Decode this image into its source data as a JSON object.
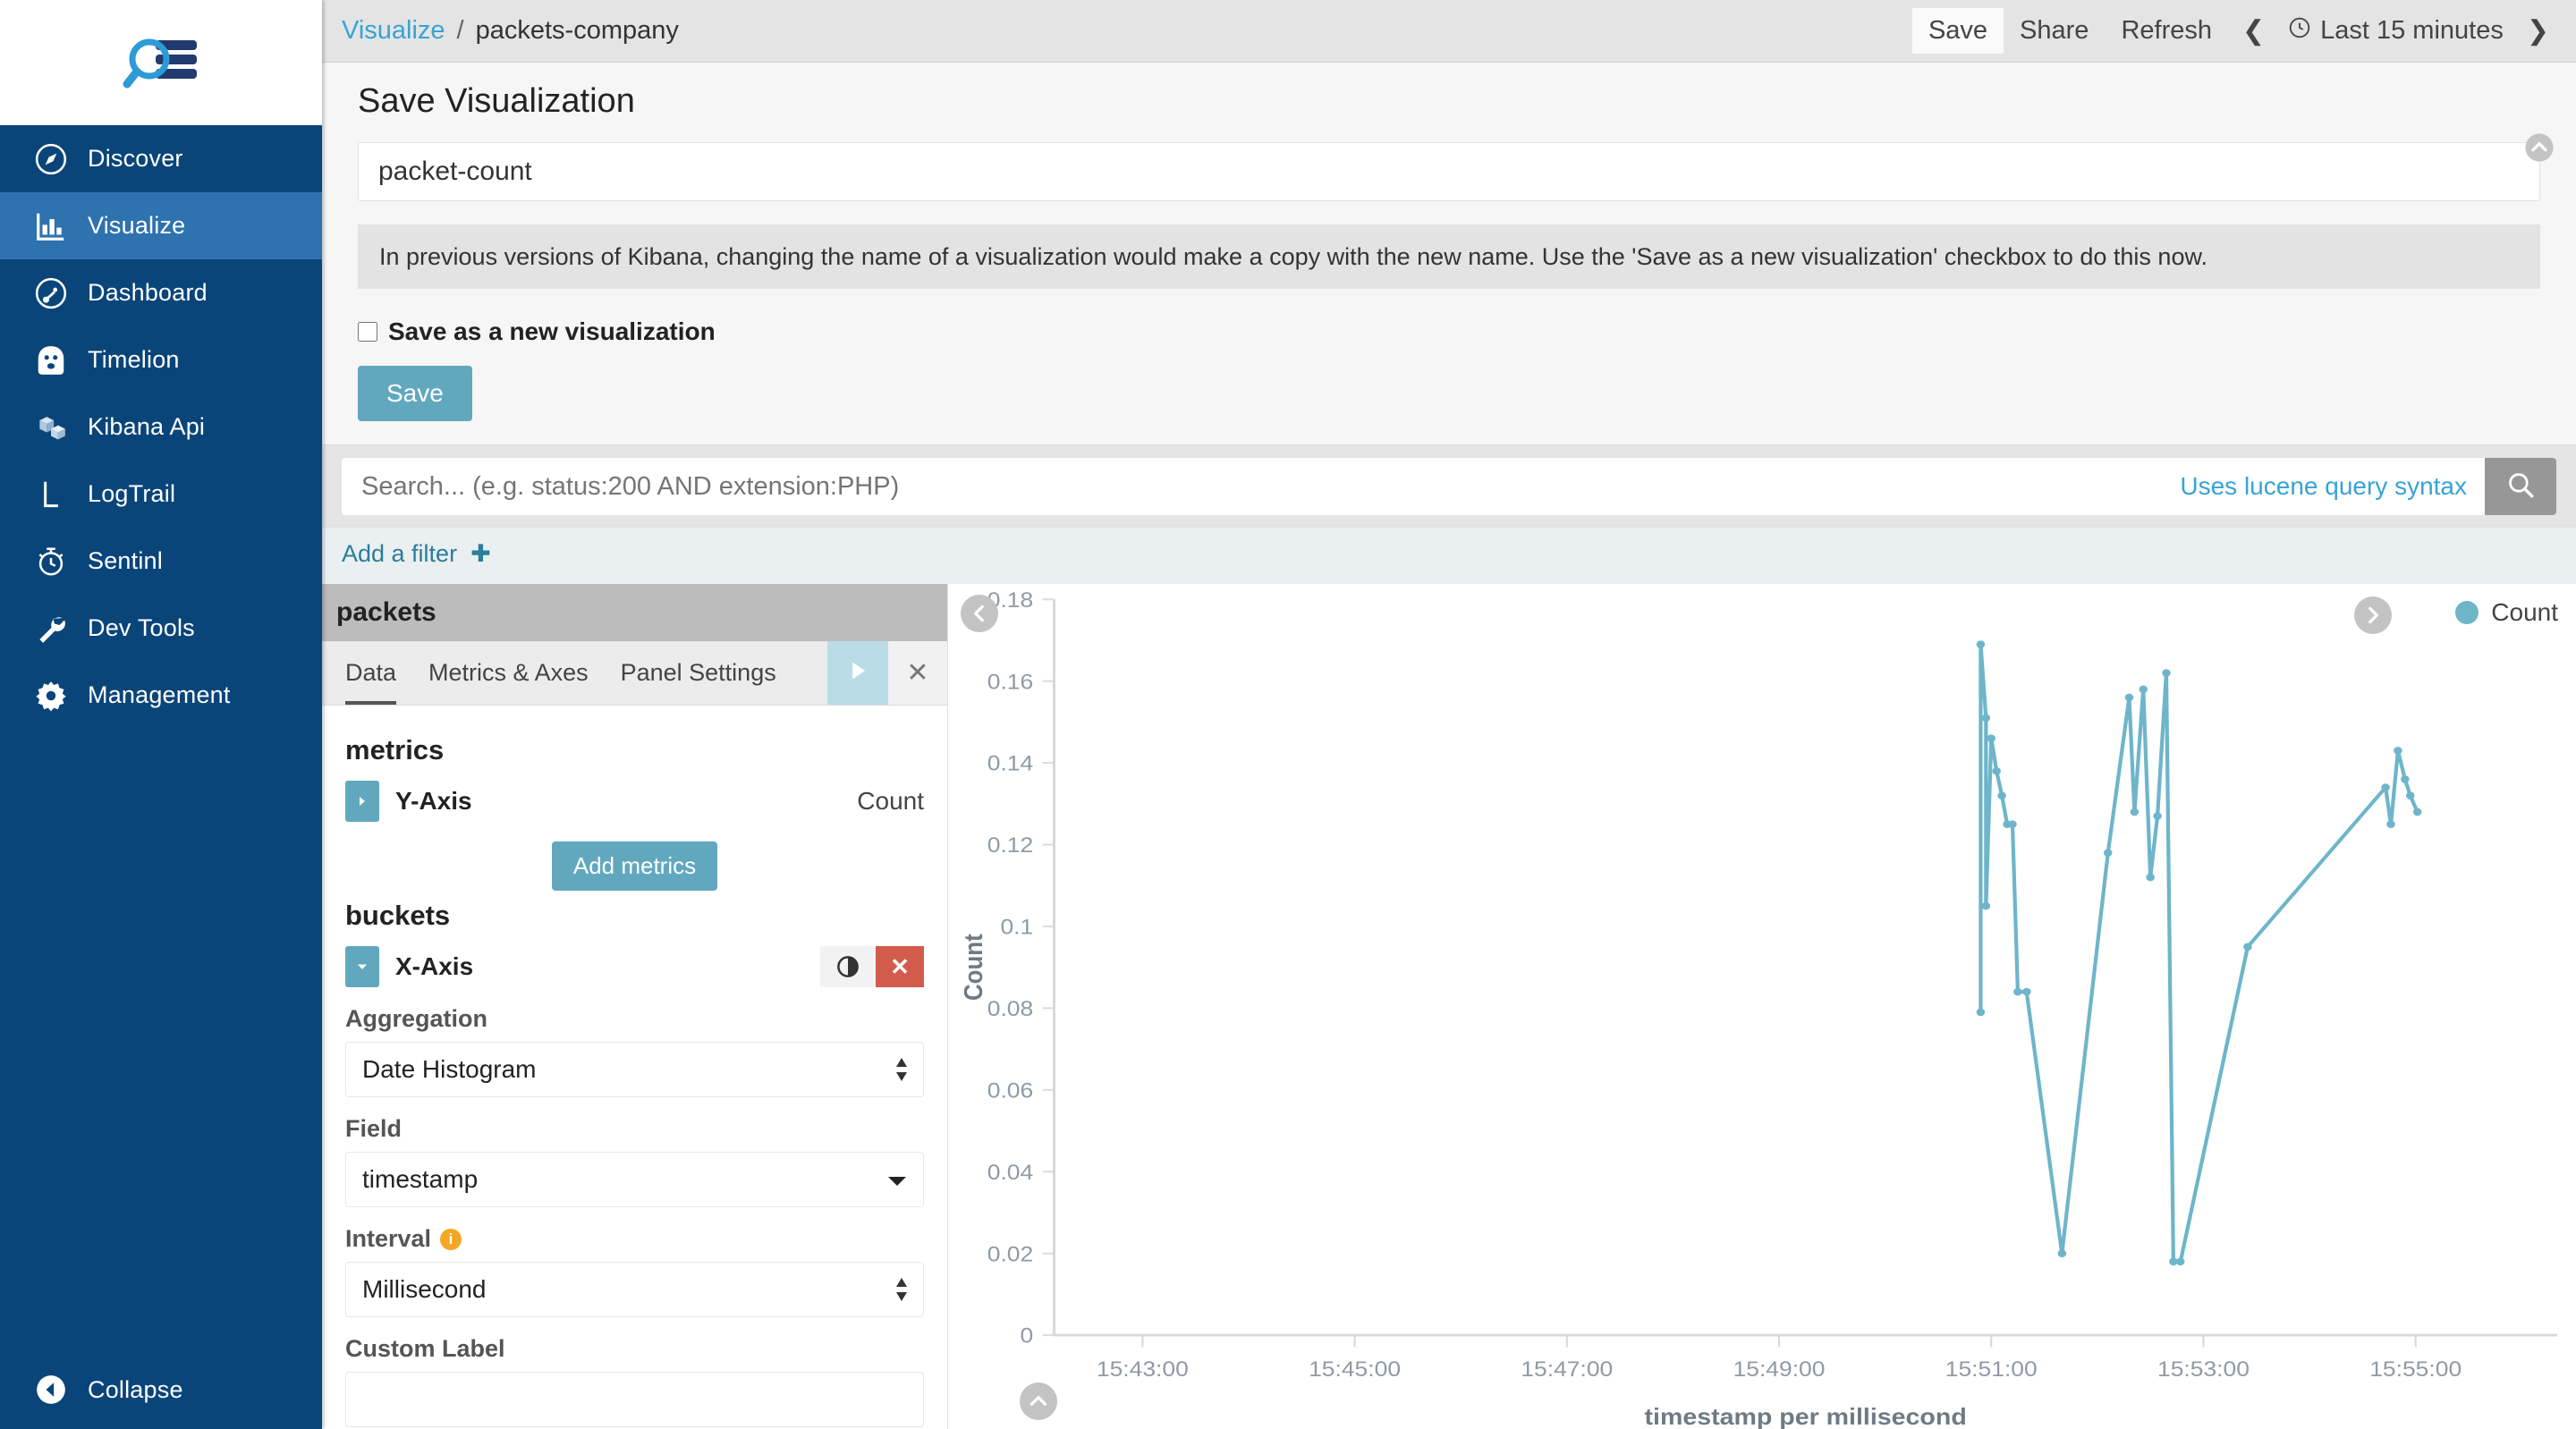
{
  "sidebar": {
    "logo_name": "kibana-logo",
    "items": [
      {
        "label": "Discover",
        "icon": "compass-icon",
        "active": false
      },
      {
        "label": "Visualize",
        "icon": "bar-chart-icon",
        "active": true
      },
      {
        "label": "Dashboard",
        "icon": "dashboard-icon",
        "active": false
      },
      {
        "label": "Timelion",
        "icon": "timelion-icon",
        "active": false
      },
      {
        "label": "Kibana Api",
        "icon": "cubes-icon",
        "active": false
      },
      {
        "label": "LogTrail",
        "icon": "letter-l-icon",
        "active": false
      },
      {
        "label": "Sentinl",
        "icon": "alarm-clock-icon",
        "active": false
      },
      {
        "label": "Dev Tools",
        "icon": "wrench-icon",
        "active": false
      },
      {
        "label": "Management",
        "icon": "gear-icon",
        "active": false
      }
    ],
    "collapse_label": "Collapse",
    "collapse_icon": "chevron-left-circle-icon"
  },
  "header": {
    "breadcrumb_root": "Visualize",
    "breadcrumb_sep": "/",
    "breadcrumb_current": "packets-company",
    "save_label": "Save",
    "share_label": "Share",
    "refresh_label": "Refresh",
    "prev_icon": "chevron-left-icon",
    "next_icon": "chevron-right-icon",
    "clock_icon": "clock-icon",
    "time_range": "Last 15 minutes"
  },
  "save_panel": {
    "title": "Save Visualization",
    "name_value": "packet-count",
    "name_placeholder": "",
    "notice": "In previous versions of Kibana, changing the name of a visualization would make a copy with the new name. Use the 'Save as a new visualization' checkbox to do this now.",
    "checkbox_label": "Save as a new visualization",
    "checkbox_checked": false,
    "save_button": "Save",
    "collapse_icon": "chevron-up-circle-icon"
  },
  "query": {
    "placeholder": "Search... (e.g. status:200 AND extension:PHP)",
    "value": "",
    "lucene_hint": "Uses lucene query syntax",
    "search_icon": "search-icon",
    "add_filter_label": "Add a filter",
    "add_filter_icon": "plus-icon"
  },
  "editor": {
    "index_title": "packets",
    "tabs": [
      {
        "label": "Data",
        "active": true
      },
      {
        "label": "Metrics & Axes",
        "active": false
      },
      {
        "label": "Panel Settings",
        "active": false
      }
    ],
    "apply_icon": "play-icon",
    "discard_icon": "close-icon",
    "metrics_title": "metrics",
    "metric": {
      "name": "Y-Axis",
      "value": "Count",
      "toggle_icon": "caret-right-icon"
    },
    "add_metrics_label": "Add metrics",
    "buckets_title": "buckets",
    "bucket": {
      "name": "X-Axis",
      "toggle_icon": "caret-down-icon",
      "axis_toggle_icon": "contrast-toggle-icon",
      "remove_icon": "close-icon"
    },
    "aggregation_label": "Aggregation",
    "aggregation_value": "Date Histogram",
    "field_label": "Field",
    "field_value": "timestamp",
    "interval_label": "Interval",
    "interval_info_icon": "info-icon",
    "interval_value": "Millisecond",
    "custom_label_label": "Custom Label",
    "custom_label_value": ""
  },
  "vis": {
    "collapse_left_icon": "chevron-left-circle-icon",
    "collapse_down_icon": "chevron-up-circle-icon",
    "legend_toggle_icon": "chevron-right-circle-icon",
    "legend_label": "Count",
    "legend_color": "#6eb5ca"
  },
  "chart_data": {
    "type": "line",
    "title": "",
    "xlabel": "timestamp per millisecond",
    "ylabel": "Count",
    "ylim": [
      0,
      0.18
    ],
    "yticks": [
      0,
      0.02,
      0.04,
      0.06,
      0.08,
      0.1,
      0.12,
      0.14,
      0.16,
      0.18
    ],
    "ytick_labels": [
      "0",
      "0.02",
      "0.04",
      "0.06",
      "0.08",
      "0.1",
      "0.12",
      "0.14",
      "0.16",
      "0.18"
    ],
    "xticks": [
      "15:43:00",
      "15:45:00",
      "15:47:00",
      "15:49:00",
      "15:51:00",
      "15:53:00",
      "15:55:00"
    ],
    "xlim": [
      "15:42:10",
      "15:56:20"
    ],
    "grid": false,
    "legend_position": "top-right",
    "series": [
      {
        "name": "Count",
        "color": "#6eb5ca",
        "x": [
          "15:50:54",
          "15:50:54",
          "15:50:57",
          "15:50:57",
          "15:51:00",
          "15:51:03",
          "15:51:06",
          "15:51:09",
          "15:51:12",
          "15:51:15",
          "15:51:20",
          "15:51:40",
          "15:52:06",
          "15:52:18",
          "15:52:21",
          "15:52:26",
          "15:52:30",
          "15:52:34",
          "15:52:39",
          "15:52:43",
          "15:52:47",
          "15:53:25",
          "15:54:43",
          "15:54:46",
          "15:54:50",
          "15:54:54",
          "15:54:57",
          "15:55:01"
        ],
        "y": [
          0.079,
          0.169,
          0.151,
          0.105,
          0.146,
          0.138,
          0.132,
          0.125,
          0.125,
          0.084,
          0.084,
          0.02,
          0.118,
          0.156,
          0.128,
          0.158,
          0.112,
          0.127,
          0.162,
          0.018,
          0.018,
          0.095,
          0.134,
          0.125,
          0.143,
          0.136,
          0.132,
          0.128
        ]
      }
    ]
  }
}
